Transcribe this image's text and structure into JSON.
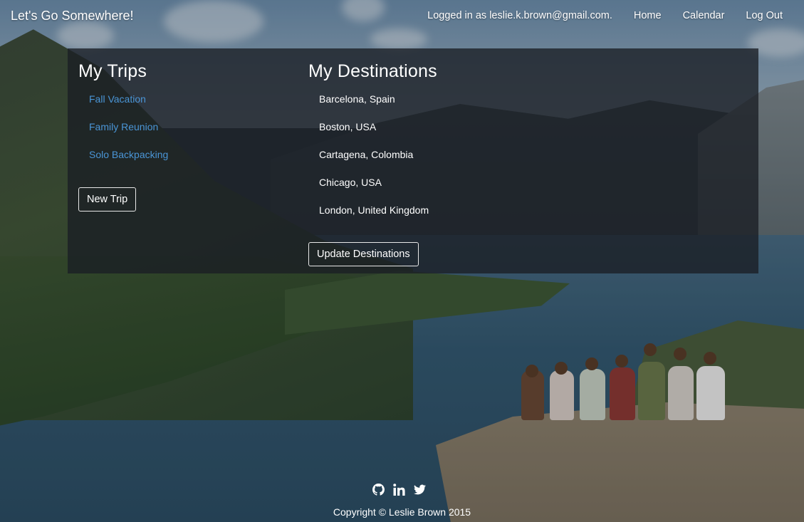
{
  "nav": {
    "brand": "Let's Go Somewhere!",
    "logged_in": "Logged in as leslie.k.brown@gmail.com.",
    "links": [
      "Home",
      "Calendar",
      "Log Out"
    ]
  },
  "trips": {
    "heading": "My Trips",
    "items": [
      "Fall Vacation",
      "Family Reunion",
      "Solo Backpacking"
    ],
    "new_button": "New Trip"
  },
  "destinations": {
    "heading": "My Destinations",
    "items": [
      "Barcelona, Spain",
      "Boston, USA",
      "Cartagena, Colombia",
      "Chicago, USA",
      "London, United Kingdom"
    ],
    "update_button": "Update Destinations"
  },
  "footer": {
    "icons": [
      "github-icon",
      "linkedin-icon",
      "twitter-icon"
    ],
    "copyright": "Copyright © Leslie Brown 2015"
  },
  "colors": {
    "link": "#4a95d6",
    "panel": "rgba(25,30,36,0.78)"
  }
}
